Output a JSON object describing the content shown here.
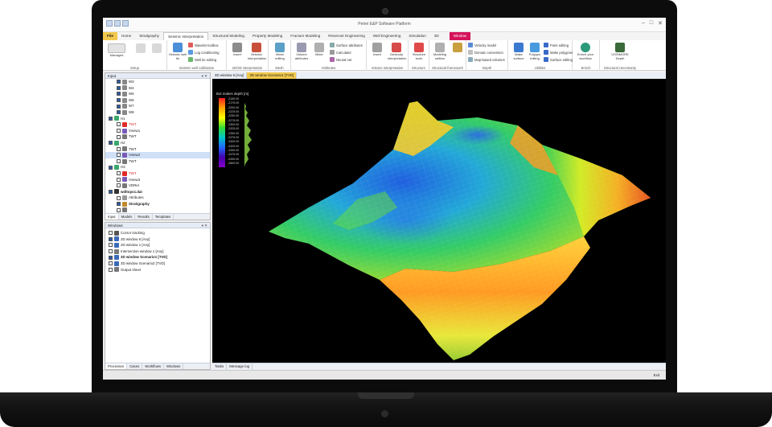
{
  "window": {
    "title": "Petrel E&P Software Platform",
    "controls": [
      "–",
      "□",
      "✕"
    ]
  },
  "ribbon_tabs": [
    {
      "label": "File",
      "kind": "file"
    },
    {
      "label": "Home",
      "kind": ""
    },
    {
      "label": "Stratigraphy",
      "kind": ""
    },
    {
      "label": "Seismic Interpretation",
      "kind": "active"
    },
    {
      "label": "Structural Modeling",
      "kind": ""
    },
    {
      "label": "Property Modeling",
      "kind": ""
    },
    {
      "label": "Fracture Modeling",
      "kind": ""
    },
    {
      "label": "Reservoir Engineering",
      "kind": ""
    },
    {
      "label": "Well Engineering",
      "kind": ""
    },
    {
      "label": "Simulation",
      "kind": ""
    },
    {
      "label": "3D",
      "kind": ""
    },
    {
      "label": "Window",
      "kind": "ctx"
    }
  ],
  "ribbon_groups": [
    "Setup",
    "Seismic-well calibration",
    "2D/3D interpretation",
    "Mesh",
    "Attributes",
    "Volume interpretation",
    "Structure",
    "Structural framework",
    "Depth",
    "Utilities",
    "Enrich",
    "Structural Uncertainty"
  ],
  "ribbon_buttons": {
    "managed": "Managed",
    "seismic_well_tie": "Seismic well tie",
    "wavelet_toolbox": "Wavelet toolbox",
    "log_conditioning": "Log conditioning",
    "well_tie_editing": "Well tie editing",
    "insert": "Insert",
    "seismic_interpretation": "Seismic interpretation",
    "mesh_editing": "Mesh editing",
    "volume_attributes": "Volume attributes",
    "mixer": "Mixer",
    "surface_attributes": "Surface attributes",
    "calculator": "Calculator",
    "neural_net": "Neural net",
    "insert2": "Insert",
    "geobody_interpretation": "Geobody interpretation",
    "structure_tools": "Structure tools",
    "modeling_wkflow": "Modeling wkflow",
    "velocity_model": "Velocity model",
    "domain_conversion": "Domain conversion",
    "map_based_volumes": "Map-based volumes",
    "make_surface": "Make surface",
    "polygon_editing": "Polygon editing",
    "point_editing": "Point editing",
    "make_polygons": "Make polygons",
    "surface_editing": "Surface editing",
    "enrich_workflow": "Enrich your workflow",
    "ussimore_depth": "USSIMORE Depth"
  },
  "input_pane": {
    "title": "Input",
    "rows": [
      {
        "label": "W3",
        "indent": 2,
        "checked": true,
        "icon": "#888888"
      },
      {
        "label": "W4",
        "indent": 2,
        "checked": true,
        "icon": "#888888"
      },
      {
        "label": "W5",
        "indent": 2,
        "checked": true,
        "icon": "#888888"
      },
      {
        "label": "W6",
        "indent": 2,
        "checked": true,
        "icon": "#888888"
      },
      {
        "label": "W7",
        "indent": 2,
        "checked": true,
        "icon": "#888888"
      },
      {
        "label": "W8",
        "indent": 2,
        "checked": true,
        "icon": "#888888"
      },
      {
        "label": "H1",
        "indent": 0,
        "checked": true,
        "icon": "#3aa86a"
      },
      {
        "label": "TWT",
        "indent": 2,
        "checked": false,
        "icon": "#e02a2a",
        "color": "#e02a2a"
      },
      {
        "label": "Vview1",
        "indent": 2,
        "checked": false,
        "icon": "#7a5ab8"
      },
      {
        "label": "TWT",
        "indent": 2,
        "checked": false,
        "icon": "#777777"
      },
      {
        "label": "H2",
        "indent": 0,
        "checked": true,
        "icon": "#3aa86a"
      },
      {
        "label": "TWT",
        "indent": 2,
        "checked": false,
        "icon": "#777777"
      },
      {
        "label": "Vview2",
        "indent": 2,
        "checked": false,
        "icon": "#7a5ab8",
        "highlight": true
      },
      {
        "label": "TWT",
        "indent": 2,
        "checked": false,
        "icon": "#777777"
      },
      {
        "label": "H3",
        "indent": 0,
        "checked": true,
        "icon": "#3aa86a"
      },
      {
        "label": "TWT",
        "indent": 2,
        "checked": false,
        "icon": "#e02a2a",
        "color": "#e02a2a"
      },
      {
        "label": "Vview3",
        "indent": 2,
        "checked": false,
        "icon": "#7a5ab8"
      },
      {
        "label": "VDRer",
        "indent": 2,
        "checked": false,
        "icon": "#777777"
      },
      {
        "label": "wdltops1.dat",
        "indent": 0,
        "checked": true,
        "icon": "#333333",
        "bold": true
      },
      {
        "label": "Attributes",
        "indent": 2,
        "checked": false,
        "icon": "#999999"
      },
      {
        "label": "Stratigraphy",
        "indent": 2,
        "checked": true,
        "icon": "#c08a2a",
        "bold": true
      },
      {
        "label": "",
        "indent": 2,
        "checked": false,
        "icon": "#777777"
      }
    ],
    "tabs": [
      "Input",
      "Models",
      "Results",
      "Templates"
    ]
  },
  "windows_pane": {
    "title": "Windows",
    "rows": [
      {
        "label": "Cursor tracking",
        "checked": false,
        "icon": "#555555"
      },
      {
        "label": "3D window 6 [Any]",
        "checked": true,
        "icon": "#3a6bb8"
      },
      {
        "label": "2D window 1 [Any]",
        "checked": false,
        "icon": "#3a6bb8"
      },
      {
        "label": "Intersection window 1 [Any]",
        "checked": false,
        "icon": "#777777"
      },
      {
        "label": "3D window Scenario1 [TVD]",
        "checked": true,
        "icon": "#3a6bb8",
        "bold": true
      },
      {
        "label": "3D window Scenario2 [TVD]",
        "checked": false,
        "icon": "#3a6bb8"
      },
      {
        "label": "Output sheet",
        "checked": false,
        "icon": "#777777"
      }
    ],
    "tabs": [
      "Processes",
      "Cases",
      "Workflows",
      "Windows"
    ]
  },
  "viewport_tabs": [
    {
      "label": "3D window 6 [Any]",
      "active": false
    },
    {
      "label": "3D window Scenario1 [TVD]",
      "active": true
    }
  ],
  "legend": {
    "title": "Bot makes depth [m]",
    "ticks": [
      "-2150.00",
      "-2175.00",
      "-2200.00",
      "-2225.00",
      "-2250.00",
      "-2275.00",
      "-2300.00",
      "-2325.00",
      "-2350.00",
      "-2375.00",
      "-2400.00",
      "-2425.00",
      "-2450.00",
      "-2475.00",
      "-2490.00",
      "-2500.00"
    ]
  },
  "bottom_tabs": [
    "Tasks",
    "Message log"
  ],
  "status": {
    "right": "Exit"
  }
}
